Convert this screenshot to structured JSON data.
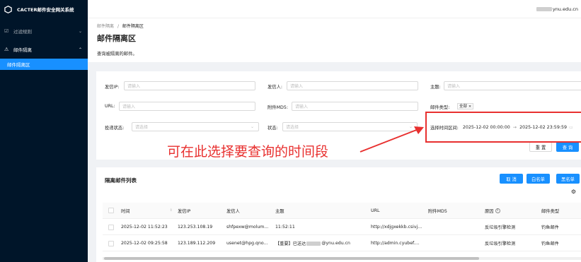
{
  "brand": {
    "name": "CACTER邮件安全网关系统"
  },
  "sidebar": {
    "items": [
      {
        "label": "过滤规则",
        "icon": "filter-icon",
        "arrow": "⌄"
      },
      {
        "label": "邮件隔离",
        "icon": "warning-icon",
        "arrow": "⌃"
      },
      {
        "label": "邮件隔离区"
      }
    ]
  },
  "header": {
    "user_suffix": "ynu.edu.cn"
  },
  "breadcrumb": {
    "parent": "邮件隔离",
    "sep": "/",
    "current": "邮件隔离区"
  },
  "page": {
    "title": "邮件隔离区",
    "description": "查询被隔离的邮件。"
  },
  "filters": {
    "sender_ip": {
      "label": "发信IP:",
      "placeholder": "请输入"
    },
    "sender": {
      "label": "发信人:",
      "placeholder": "请输入"
    },
    "subject": {
      "label": "主题:",
      "placeholder": "请输入"
    },
    "url": {
      "label": "URL:",
      "placeholder": "请输入"
    },
    "attachment_md5": {
      "label": "附件MD5:",
      "placeholder": "请输入"
    },
    "mail_type": {
      "label": "邮件类型:",
      "tag": "全部",
      "tag_close": "×"
    },
    "delivery_status": {
      "label": "投递状态:",
      "placeholder": "请选择"
    },
    "status": {
      "label": "状态:",
      "placeholder": "请选择"
    },
    "time_range": {
      "label": "选择时间区间:",
      "start": "2025-12-02 00:00:00",
      "arrow": "→",
      "end": "2025-12-02 23:59:59"
    },
    "reset_label": "重 置",
    "query_label": "查 询"
  },
  "annotation": {
    "text": "可在此选择要查询的时间段",
    "color": "#e8302f"
  },
  "list": {
    "title": "隔离邮件列表",
    "actions": {
      "cancel": "取 消",
      "whitelist": "白名单",
      "blacklist": "黑名单"
    },
    "columns": [
      "时间",
      "发信IP",
      "发信人",
      "主题",
      "URL",
      "附件MD5",
      "原因",
      "邮件类型"
    ],
    "rows": [
      {
        "time": "2025-12-02 11:52:23",
        "ip": "123.253.108.19",
        "sender": "shfpexw@molum...",
        "subject": "11:52:11",
        "url": "http://xdjgxekkb.csivj...",
        "md5": "",
        "reason": "反垃圾引擎检测",
        "type": "钓鱼邮件"
      },
      {
        "time": "2025-12-02 09:25:58",
        "ip": "123.189.112.209",
        "sender": "usenet@hpg.qno...",
        "subject_prefix": "【重要】已送达",
        "subject_suffix": "@ynu.edu.cn",
        "url": "http://admin.cyubef....",
        "md5": "",
        "reason": "反垃圾引擎检测",
        "type": "钓鱼邮件"
      }
    ]
  },
  "colors": {
    "sidebar_bg": "#001529",
    "primary": "#1890ff",
    "annotation": "#e8302f"
  }
}
